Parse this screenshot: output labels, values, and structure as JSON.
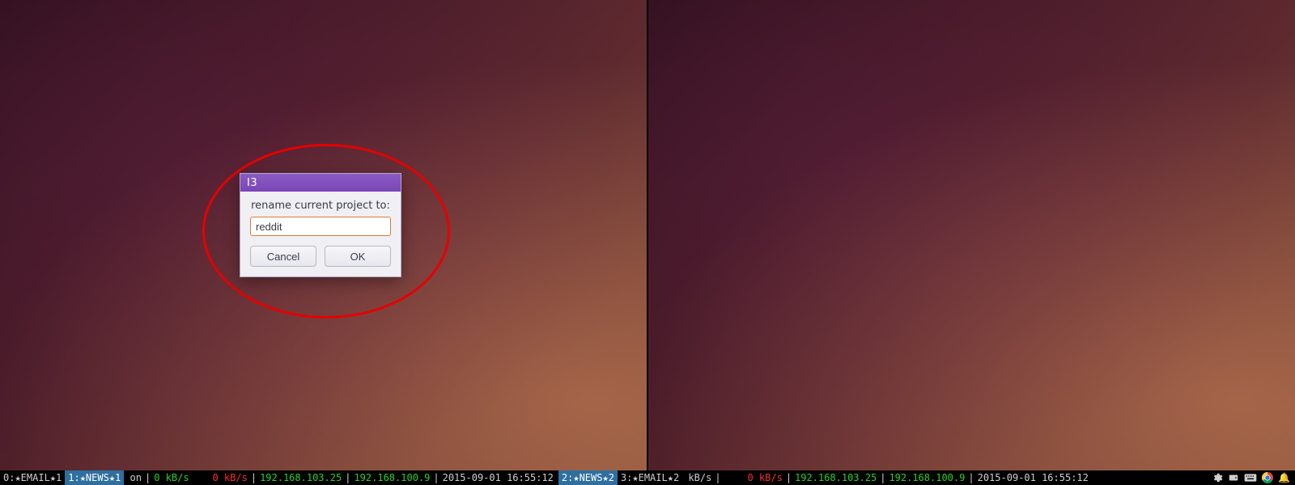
{
  "dialog": {
    "title": "I3",
    "label": "rename current project to:",
    "input_value": "reddit",
    "cancel_label": "Cancel",
    "ok_label": "OK"
  },
  "bar": {
    "left": {
      "workspaces": [
        {
          "id": "ws-email-1",
          "label": "0:★EMAIL★1",
          "active": false
        },
        {
          "id": "ws-news-1",
          "label": "1:★NEWS★1",
          "active": true
        }
      ],
      "vpn_text": "on",
      "net_down": "0 kB/s",
      "net_up": "0 kB/s",
      "ip_a": "192.168.103.25",
      "ip_b": "192.168.100.9",
      "clock": "2015-09-01 16:55:12"
    },
    "right": {
      "workspaces": [
        {
          "id": "ws-news-2",
          "label": "2:★NEWS★2",
          "active": true
        },
        {
          "id": "ws-email-2",
          "label": "3:★EMAIL★2",
          "active": false
        }
      ],
      "kbs_label": "kB/s",
      "net_up": "0 kB/s",
      "ip_a": "192.168.103.25",
      "ip_b": "192.168.100.9",
      "clock": "2015-09-01 16:55:12"
    },
    "sep": "|"
  },
  "tray": {
    "icons": [
      "settings-icon",
      "hdd-icon",
      "keyboard-icon",
      "chrome-icon",
      "notification-icon"
    ]
  }
}
